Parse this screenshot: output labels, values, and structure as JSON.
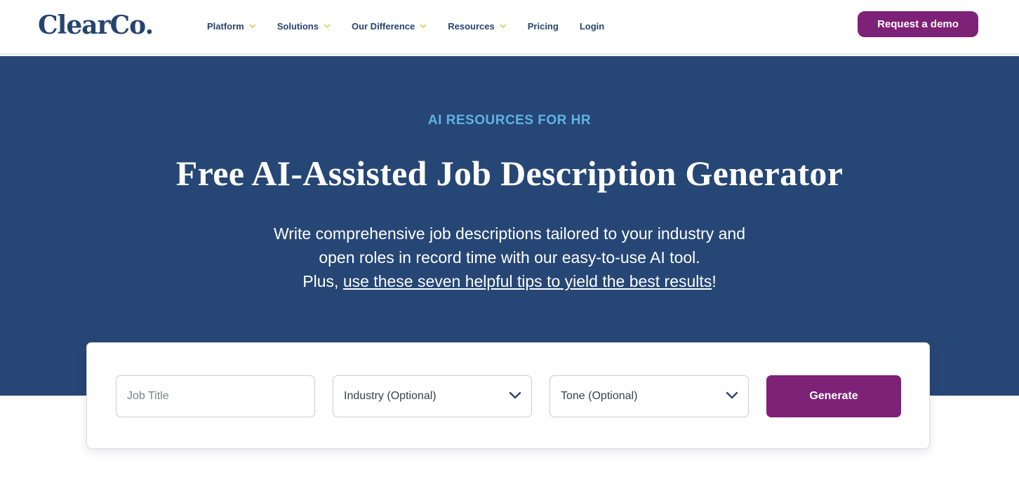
{
  "header": {
    "logo_text": "ClearCo",
    "nav": [
      {
        "label": "Platform",
        "has_dropdown": true
      },
      {
        "label": "Solutions",
        "has_dropdown": true
      },
      {
        "label": "Our Difference",
        "has_dropdown": true
      },
      {
        "label": "Resources",
        "has_dropdown": true
      },
      {
        "label": "Pricing",
        "has_dropdown": false
      },
      {
        "label": "Login",
        "has_dropdown": false
      }
    ],
    "cta_label": "Request a demo"
  },
  "hero": {
    "eyebrow": "AI RESOURCES FOR HR",
    "title": "Free AI-Assisted Job Description Generator",
    "subtitle_line1": "Write comprehensive job descriptions tailored to your industry and",
    "subtitle_line2": "open roles in record time with our easy-to-use AI tool.",
    "subtitle_line3_prefix": "Plus, ",
    "subtitle_link": "use these seven helpful tips to yield the best results",
    "subtitle_line3_suffix": "!"
  },
  "form": {
    "job_title_placeholder": "Job Title",
    "industry_label": "Industry (Optional)",
    "tone_label": "Tone (Optional)",
    "generate_label": "Generate"
  },
  "colors": {
    "brand_navy": "#26446f",
    "hero_bg": "#264675",
    "accent_purple": "#7d2276",
    "eyebrow_blue": "#5fb3e4",
    "chevron_yellow": "#e0c95a"
  },
  "icons": {
    "nav_dropdown": "chevron-down-icon",
    "select_dropdown": "chevron-down-icon"
  }
}
